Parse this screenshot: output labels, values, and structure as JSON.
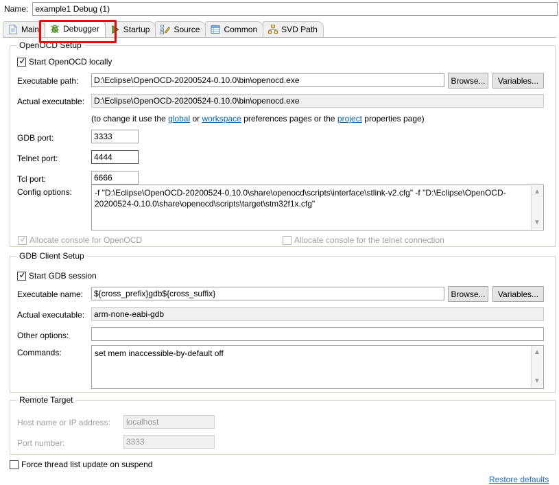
{
  "name_row": {
    "label": "Name:",
    "value": "example1 Debug (1)"
  },
  "tabs": [
    {
      "label": "Main",
      "icon": "document-icon",
      "active": false
    },
    {
      "label": "Debugger",
      "icon": "bug-icon",
      "active": true
    },
    {
      "label": "Startup",
      "icon": "play-icon",
      "active": false
    },
    {
      "label": "Source",
      "icon": "source-icon",
      "active": false
    },
    {
      "label": "Common",
      "icon": "table-icon",
      "active": false
    },
    {
      "label": "SVD Path",
      "icon": "hierarchy-icon",
      "active": false
    }
  ],
  "openocd": {
    "legend": "OpenOCD Setup",
    "start_locally_label": "Start OpenOCD locally",
    "start_locally_checked": true,
    "executable_path_label": "Executable path:",
    "executable_path_value": "D:\\Eclipse\\OpenOCD-20200524-0.10.0\\bin\\openocd.exe",
    "actual_executable_label": "Actual executable:",
    "actual_executable_value": "D:\\Eclipse\\OpenOCD-20200524-0.10.0\\bin\\openocd.exe",
    "browse_label": "Browse...",
    "variables_label": "Variables...",
    "hint_prefix": "(to change it use the ",
    "hint_link_global": "global",
    "hint_mid1": " or ",
    "hint_link_workspace": "workspace",
    "hint_mid2": " preferences pages or the ",
    "hint_link_project": "project",
    "hint_suffix": " properties page)",
    "gdb_port_label": "GDB port:",
    "gdb_port_value": "3333",
    "telnet_port_label": "Telnet port:",
    "telnet_port_value": "4444",
    "tcl_port_label": "Tcl port:",
    "tcl_port_value": "6666",
    "config_options_label": "Config options:",
    "config_options_value": "-f \"D:\\Eclipse\\OpenOCD-20200524-0.10.0\\share\\openocd\\scripts\\interface\\stlink-v2.cfg\" -f \"D:\\Eclipse\\OpenOCD-20200524-0.10.0\\share\\openocd\\scripts\\target\\stm32f1x.cfg\"",
    "allocate_console_openocd_label": "Allocate console for OpenOCD",
    "allocate_console_openocd_checked": true,
    "allocate_console_telnet_label": "Allocate console for the telnet connection",
    "allocate_console_telnet_checked": false
  },
  "gdb_client": {
    "legend": "GDB Client Setup",
    "start_session_label": "Start GDB session",
    "start_session_checked": true,
    "executable_name_label": "Executable name:",
    "executable_name_value": "${cross_prefix}gdb${cross_suffix}",
    "browse_label": "Browse...",
    "variables_label": "Variables...",
    "actual_executable_label": "Actual executable:",
    "actual_executable_value": "arm-none-eabi-gdb",
    "other_options_label": "Other options:",
    "other_options_value": "",
    "commands_label": "Commands:",
    "commands_value": "set mem inaccessible-by-default off"
  },
  "remote_target": {
    "legend": "Remote Target",
    "host_label": "Host name or IP address:",
    "host_value": "localhost",
    "port_label": "Port number:",
    "port_value": "3333"
  },
  "footer": {
    "force_thread_label": "Force thread list update on suspend",
    "force_thread_checked": false,
    "restore_defaults_label": "Restore defaults"
  },
  "colors": {
    "accent_link": "#0062b1",
    "annotation_red": "#fe0000",
    "disabled_text": "#a0a0a0"
  }
}
